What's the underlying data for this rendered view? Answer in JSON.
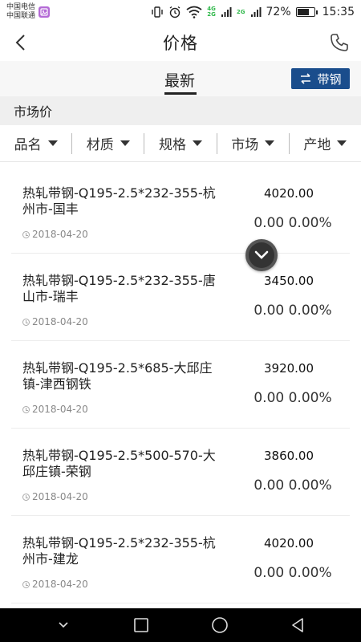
{
  "status_bar": {
    "carrier_1": "中国电信",
    "carrier_2": "中国联通",
    "net_tag_top": "4G",
    "net_tag_mid": "2G",
    "net_tag_bottom": "2G",
    "battery_percent": "72%",
    "battery_level": 0.72,
    "time": "15:35"
  },
  "header": {
    "title": "价格"
  },
  "tabs": {
    "latest": "最新",
    "filter_chip": "带钢"
  },
  "section": {
    "title": "市场价"
  },
  "filters": [
    {
      "label": "品名"
    },
    {
      "label": "材质"
    },
    {
      "label": "规格"
    },
    {
      "label": "市场"
    },
    {
      "label": "产地"
    }
  ],
  "items": [
    {
      "name": "热轧带钢-Q195-2.5*232-355-杭州市-国丰",
      "date": "2018-04-20",
      "price": "4020.00",
      "change": "0.00 0.00%"
    },
    {
      "name": "热轧带钢-Q195-2.5*232-355-唐山市-瑞丰",
      "date": "2018-04-20",
      "price": "3450.00",
      "change": "0.00 0.00%"
    },
    {
      "name": "热轧带钢-Q195-2.5*685-大邱庄镇-津西钢铁",
      "date": "2018-04-20",
      "price": "3920.00",
      "change": "0.00 0.00%"
    },
    {
      "name": "热轧带钢-Q195-2.5*500-570-大邱庄镇-荣钢",
      "date": "2018-04-20",
      "price": "3860.00",
      "change": "0.00 0.00%"
    },
    {
      "name": "热轧带钢-Q195-2.5*232-355-杭州市-建龙",
      "date": "2018-04-20",
      "price": "4020.00",
      "change": "0.00 0.00%"
    }
  ],
  "icons": {
    "back": "chevron-left-icon",
    "phone": "phone-icon",
    "swap": "swap-arrows-icon",
    "scroll": "chevron-down-icon"
  },
  "colors": {
    "accent": "#1a4d8c",
    "nav_bar": "#000000"
  }
}
